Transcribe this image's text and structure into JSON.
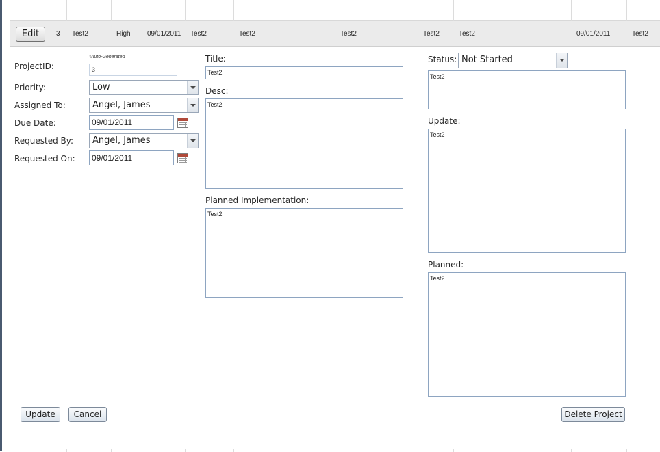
{
  "grid": {
    "edit_label": "Edit",
    "row": [
      "3",
      "Test2",
      "High",
      "09/01/2011",
      "Test2",
      "Test2",
      "Test2",
      "Test2",
      "Test2",
      "09/01/2011",
      "Test2"
    ]
  },
  "form": {
    "auto_generated_note": "*Auto-Generated",
    "project_id_label": "ProjectID:",
    "project_id_value": "3",
    "priority_label": "Priority:",
    "priority_value": "Low",
    "assigned_to_label": "Assigned To:",
    "assigned_to_value": "Angel, James",
    "due_date_label": "Due Date:",
    "due_date_value": "09/01/2011",
    "requested_by_label": "Requested By:",
    "requested_by_value": "Angel, James",
    "requested_on_label": "Requested On:",
    "requested_on_value": "09/01/2011",
    "title_label": "Title:",
    "title_value": "Test2",
    "desc_label": "Desc:",
    "desc_value": "Test2",
    "planned_impl_label": "Planned Implementation:",
    "planned_impl_value": "Test2",
    "status_label": "Status:",
    "status_value": "Not Started",
    "status_note_value": "Test2",
    "update_label": "Update:",
    "update_value": "Test2",
    "planned_label": "Planned:",
    "planned_value": "Test2"
  },
  "buttons": {
    "update": "Update",
    "cancel": "Cancel",
    "delete": "Delete Project"
  },
  "icons": {
    "dropdown": "chevron-down-icon",
    "calendar": "calendar-icon"
  }
}
